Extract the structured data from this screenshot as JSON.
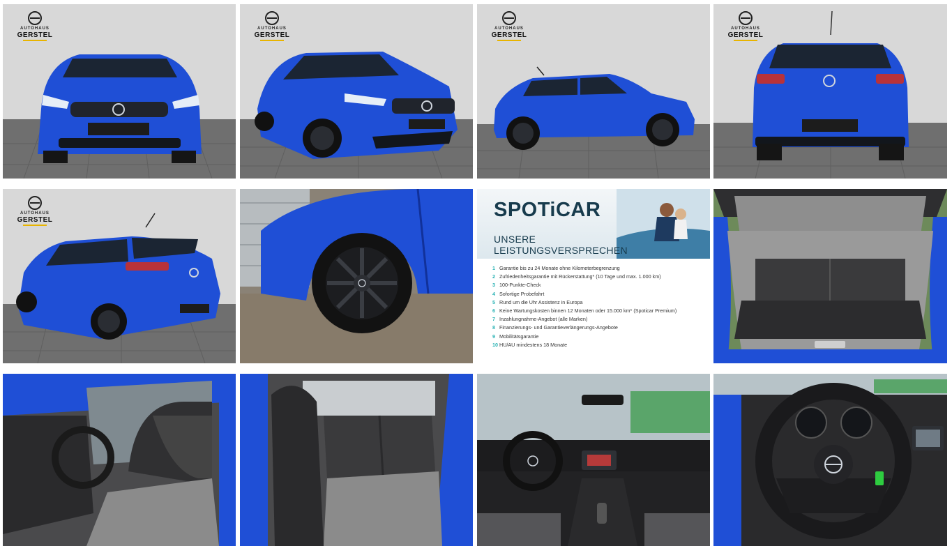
{
  "dealer": {
    "brand_line": "AUTOHAUS",
    "name": "GERSTEL",
    "plate_text": "SPOTiCAR"
  },
  "promo": {
    "brand": "SPOTiCAR",
    "heading_line1": "UNSERE",
    "heading_line2": "LEISTUNGSVERSPRECHEN",
    "items": [
      {
        "num": "1",
        "text": "Garantie bis zu 24 Monate ohne Kilometerbegrenzung"
      },
      {
        "num": "2",
        "text": "Zufriedenheitsgarantie mit Rückerstattung* (10 Tage und max. 1.000 km)"
      },
      {
        "num": "3",
        "text": "100-Punkte-Check"
      },
      {
        "num": "4",
        "text": "Sofortige Probefahrt"
      },
      {
        "num": "5",
        "text": "Rund um die Uhr Assistenz in Europa"
      },
      {
        "num": "6",
        "text": "Keine Wartungskosten binnen 12 Monaten oder 15.000 km* (Spoticar Premium)"
      },
      {
        "num": "7",
        "text": "Inzahlungnahme-Angebot (alle Marken)"
      },
      {
        "num": "8",
        "text": "Finanzierungs- und Garantieverlängerungs-Angebote"
      },
      {
        "num": "9",
        "text": "Mobilitätsgarantie"
      },
      {
        "num": "10",
        "text": "HU/AU mindestens 18 Monate"
      }
    ]
  },
  "colors": {
    "car_blue": "#1f4fd6",
    "car_blue_dark": "#11319a",
    "studio_wall": "#d6d6d6",
    "studio_floor": "#6e6e6e",
    "spoticar_teal": "#2bb3b5",
    "spoticar_navy": "#173b4d",
    "dealer_accent": "#e8b400"
  },
  "icons": {
    "car_brand": "opel-logo-icon",
    "wheel": "alloy-wheel-icon"
  }
}
